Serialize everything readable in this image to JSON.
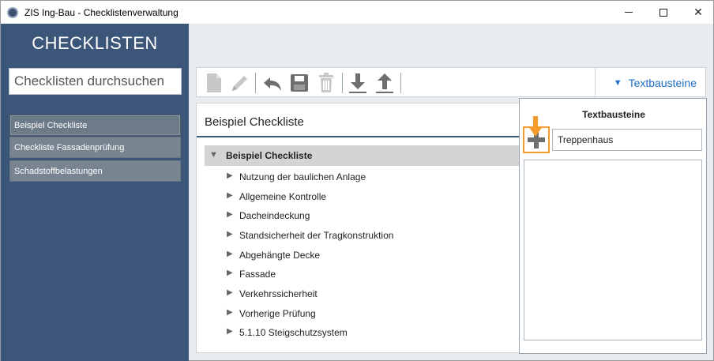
{
  "window": {
    "title": "ZIS Ing-Bau - Checklistenverwaltung",
    "controls": {
      "close_glyph": "✕"
    }
  },
  "sidebar": {
    "title": "CHECKLISTEN",
    "search": {
      "placeholder": "Checklisten durchsuchen",
      "value": ""
    },
    "items": [
      {
        "label": "Beispiel Checkliste",
        "selected": true
      },
      {
        "label": "Checkliste Fassadenprüfung",
        "selected": false
      },
      {
        "label": "Schadstoffbelastungen",
        "selected": false
      }
    ]
  },
  "toolbar": {
    "icons": [
      "new-document-icon",
      "edit-pencil-icon",
      "undo-icon",
      "save-icon",
      "delete-trash-icon",
      "download-icon",
      "upload-icon"
    ],
    "textbausteine_label": "Textbausteine",
    "textbausteine_glyph": "▼"
  },
  "main": {
    "title": "Beispiel Checkliste",
    "tree": {
      "root": {
        "label": "Beispiel Checkliste",
        "expanded_glyph": "▼"
      },
      "collapsed_glyph": "▶",
      "items": [
        "Nutzung der baulichen Anlage",
        "Allgemeine Kontrolle",
        "Dacheindeckung",
        "Standsicherheit der Tragkonstruktion",
        "Abgehängte Decke",
        "Fassade",
        "Verkehrssicherheit",
        "Vorherige Prüfung",
        "5.1.10 Steigschutzsystem"
      ]
    }
  },
  "textbausteine_panel": {
    "title": "Textbausteine",
    "input_value": "Treppenhaus"
  },
  "colors": {
    "sidebar_bg": "#3b5679",
    "accent_blue": "#1f6fc4",
    "highlight_orange": "#f49b2b",
    "icon_gray": "#6e6e6e"
  }
}
